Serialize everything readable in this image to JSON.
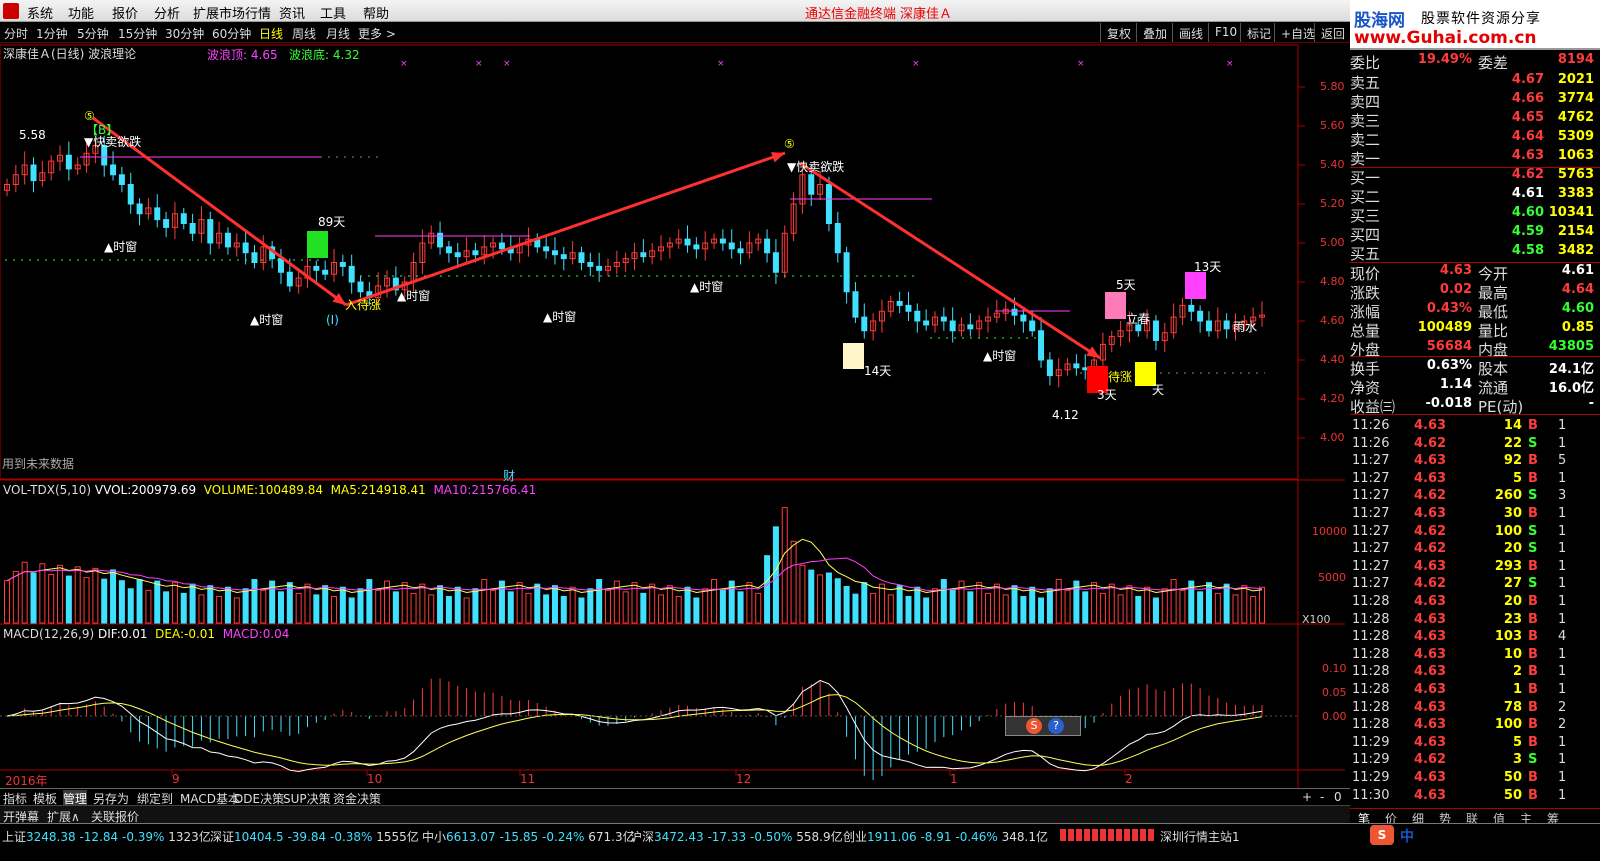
{
  "menu": {
    "items": [
      "系统",
      "功能",
      "报价",
      "分析",
      "扩展市场行情",
      "资讯",
      "工具",
      "帮助"
    ],
    "title": "通达信金融终端",
    "stock_title": "深康佳Ａ"
  },
  "window_buttons": [
    "_",
    "□",
    "×"
  ],
  "period": {
    "items": [
      "分时",
      "1分钟",
      "5分钟",
      "15分钟",
      "30分钟",
      "60分钟",
      "日线",
      "周线",
      "月线",
      "更多 >"
    ],
    "selected": "日线",
    "right": [
      "复权",
      "叠加",
      "画线",
      "F10",
      "标记",
      "+自选",
      "返回"
    ]
  },
  "chart": {
    "stock": "深康佳Ａ(日线) 波浪理论",
    "wave_top_label": "波浪顶:",
    "wave_top": "4.65",
    "wave_bottom_label": "波浪底:",
    "wave_bottom": "4.32",
    "future_note": "用到未来数据",
    "cai": "财",
    "yaxis": [
      "5.80",
      "5.60",
      "5.40",
      "5.20",
      "5.00",
      "4.80",
      "4.60",
      "4.40",
      "4.20",
      "4.00"
    ],
    "high_label": "5.58",
    "low_label": "4.12",
    "annotations": {
      "sell1": "快卖欲跌",
      "sell2": "快卖欲跌",
      "buy1": "入待涨",
      "buy2": "待涨",
      "timing": "▲时窗",
      "d89": "89天",
      "d5": "5天",
      "d13": "13天",
      "d14": "14天",
      "d3": "3天",
      "d1": "天",
      "lichun": "立春",
      "yushui": "雨水",
      "wave1": "(I)",
      "wave5": "⑤",
      "b": "【B】"
    }
  },
  "volume": {
    "name": "VOL-TDX(5,10)",
    "vvol_label": "VVOL:",
    "vvol": "200979.69",
    "volume_label": "VOLUME:",
    "volume": "100489.84",
    "ma5_label": "MA5:",
    "ma5": "214918.41",
    "ma10_label": "MA10:",
    "ma10": "215766.41",
    "yaxis": [
      "10000",
      "5000"
    ],
    "unit": "X100"
  },
  "macd": {
    "name": "MACD(12,26,9)",
    "dif_label": "DIF:",
    "dif": "0.01",
    "dea_label": "DEA:",
    "dea": "-0.01",
    "macd_label": "MACD:",
    "macd": "0.04",
    "yaxis": [
      "0.10",
      "0.05",
      "0.00"
    ]
  },
  "xaxis": [
    "2016年",
    "9",
    "10",
    "11",
    "12",
    "1",
    "2"
  ],
  "tabs": {
    "row1": [
      "指标",
      "模板",
      "管理",
      "另存为",
      "绑定到",
      "MACD基本",
      "DDE决策",
      "SUP决策",
      "资金决策"
    ],
    "selected": "管理",
    "row2": [
      "开弹幕",
      "扩展∧",
      "关联报价"
    ],
    "ctrl": [
      "+",
      "-",
      "0"
    ]
  },
  "logo": {
    "l1": "股海网",
    "l2": "股票软件资源分享",
    "l3": "www.Guhai.com.cn"
  },
  "quote": {
    "weibi": {
      "label": "委比",
      "value": "19.49%",
      "label2": "委差",
      "value2": "8194"
    },
    "asks": [
      {
        "label": "卖五",
        "price": "4.67",
        "vol": "2021"
      },
      {
        "label": "卖四",
        "price": "4.66",
        "vol": "3774"
      },
      {
        "label": "卖三",
        "price": "4.65",
        "vol": "4762"
      },
      {
        "label": "卖二",
        "price": "4.64",
        "vol": "5309"
      },
      {
        "label": "卖一",
        "price": "4.63",
        "vol": "1063"
      }
    ],
    "bids": [
      {
        "label": "买一",
        "price": "4.62",
        "vol": "5763"
      },
      {
        "label": "买二",
        "price": "4.61",
        "vol": "3383"
      },
      {
        "label": "买三",
        "price": "4.60",
        "vol": "10341"
      },
      {
        "label": "买四",
        "price": "4.59",
        "vol": "2154"
      },
      {
        "label": "买五",
        "price": "4.58",
        "vol": "3482"
      }
    ],
    "stats": [
      {
        "k": "现价",
        "v": "4.63",
        "k2": "今开",
        "v2": "4.61"
      },
      {
        "k": "涨跌",
        "v": "0.02",
        "k2": "最高",
        "v2": "4.64"
      },
      {
        "k": "涨幅",
        "v": "0.43%",
        "k2": "最低",
        "v2": "4.60"
      },
      {
        "k": "总量",
        "v": "100489",
        "k2": "量比",
        "v2": "0.85"
      },
      {
        "k": "外盘",
        "v": "56684",
        "k2": "内盘",
        "v2": "43805"
      }
    ],
    "stats2": [
      {
        "k": "换手",
        "v": "0.63%",
        "k2": "股本",
        "v2": "24.1亿"
      },
      {
        "k": "净资",
        "v": "1.14",
        "k2": "流通",
        "v2": "16.0亿"
      },
      {
        "k": "收益㈢",
        "v": "-0.018",
        "k2": "PE(动)",
        "v2": "-"
      }
    ]
  },
  "ticks": [
    {
      "t": "11:26",
      "p": "4.63",
      "v": "14",
      "d": "B",
      "n": "1"
    },
    {
      "t": "11:26",
      "p": "4.62",
      "v": "22",
      "d": "S",
      "n": "1"
    },
    {
      "t": "11:27",
      "p": "4.63",
      "v": "92",
      "d": "B",
      "n": "5"
    },
    {
      "t": "11:27",
      "p": "4.63",
      "v": "5",
      "d": "B",
      "n": "1"
    },
    {
      "t": "11:27",
      "p": "4.62",
      "v": "260",
      "d": "S",
      "n": "3"
    },
    {
      "t": "11:27",
      "p": "4.63",
      "v": "30",
      "d": "B",
      "n": "1"
    },
    {
      "t": "11:27",
      "p": "4.62",
      "v": "100",
      "d": "S",
      "n": "1"
    },
    {
      "t": "11:27",
      "p": "4.62",
      "v": "20",
      "d": "S",
      "n": "1"
    },
    {
      "t": "11:27",
      "p": "4.63",
      "v": "293",
      "d": "B",
      "n": "1"
    },
    {
      "t": "11:27",
      "p": "4.62",
      "v": "27",
      "d": "S",
      "n": "1"
    },
    {
      "t": "11:28",
      "p": "4.63",
      "v": "20",
      "d": "B",
      "n": "1"
    },
    {
      "t": "11:28",
      "p": "4.63",
      "v": "23",
      "d": "B",
      "n": "1"
    },
    {
      "t": "11:28",
      "p": "4.63",
      "v": "103",
      "d": "B",
      "n": "4"
    },
    {
      "t": "11:28",
      "p": "4.63",
      "v": "10",
      "d": "B",
      "n": "1"
    },
    {
      "t": "11:28",
      "p": "4.63",
      "v": "2",
      "d": "B",
      "n": "1"
    },
    {
      "t": "11:28",
      "p": "4.63",
      "v": "1",
      "d": "B",
      "n": "1"
    },
    {
      "t": "11:28",
      "p": "4.63",
      "v": "78",
      "d": "B",
      "n": "2"
    },
    {
      "t": "11:28",
      "p": "4.63",
      "v": "100",
      "d": "B",
      "n": "2"
    },
    {
      "t": "11:29",
      "p": "4.63",
      "v": "5",
      "d": "B",
      "n": "1"
    },
    {
      "t": "11:29",
      "p": "4.62",
      "v": "3",
      "d": "S",
      "n": "1"
    },
    {
      "t": "11:29",
      "p": "4.63",
      "v": "50",
      "d": "B",
      "n": "1"
    },
    {
      "t": "11:30",
      "p": "4.63",
      "v": "50",
      "d": "B",
      "n": "1"
    }
  ],
  "bottom_tabs": [
    "笔",
    "价",
    "细",
    "势",
    "联",
    "值",
    "主",
    "筹"
  ],
  "status": {
    "sh": {
      "name": "上证",
      "v": "3248.38",
      "c": "-12.84",
      "p": "-0.39%",
      "a": "1323亿"
    },
    "sz": {
      "name": "深证",
      "v": "10404.5",
      "c": "-39.84",
      "p": "-0.38%",
      "a": "1555亿"
    },
    "zx": {
      "name": "中小",
      "v": "6613.07",
      "c": "-15.85",
      "p": "-0.24%",
      "a": "671.3亿"
    },
    "hs": {
      "name": "沪深",
      "v": "3472.43",
      "c": "-17.33",
      "p": "-0.50%",
      "a": "558.9亿"
    },
    "cy": {
      "name": "创业",
      "v": "1911.06",
      "c": "-8.91",
      "p": "-0.46%",
      "a": "348.1亿"
    },
    "server": "深圳行情主站1",
    "tray": "中"
  },
  "colors": {
    "up": "#ff3b3b",
    "down": "#40e0ff",
    "ma5": "#ffffff",
    "ma10": "#ffff55",
    "ma20": "#ff40ff",
    "arrow": "#ff3030"
  }
}
